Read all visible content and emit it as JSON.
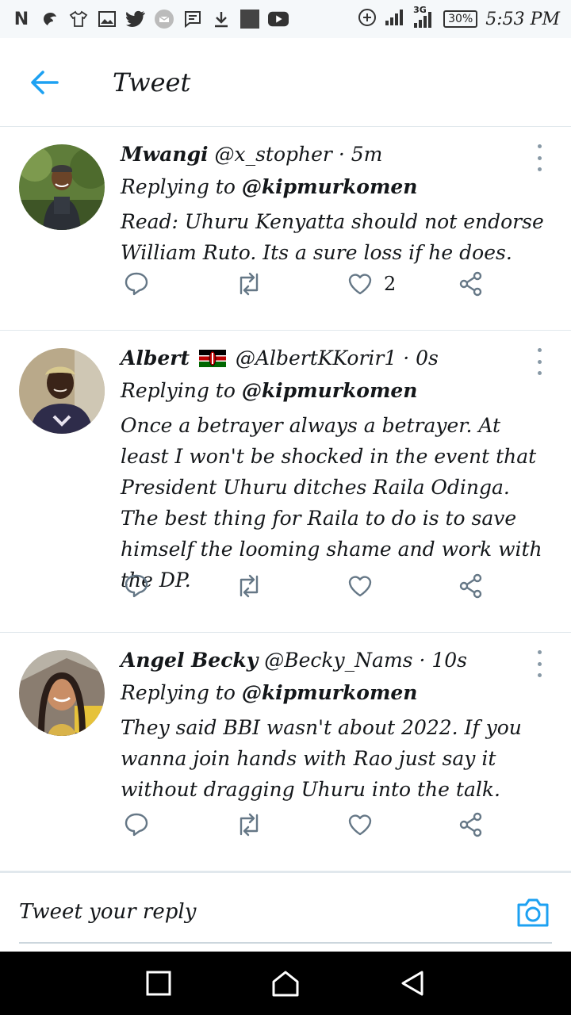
{
  "status_bar": {
    "left_icons": [
      "netflix-icon",
      "game-icon",
      "shirt-icon",
      "gallery-icon",
      "twitter-icon",
      "messenger-icon",
      "sms-icon",
      "download-icon",
      "square-icon",
      "youtube-icon"
    ],
    "network_label": "3G",
    "battery": "30%",
    "time": "5:53 PM"
  },
  "header": {
    "title": "Tweet"
  },
  "tweets": [
    {
      "name": "Mwangi",
      "handle": "@x_stopher",
      "time": "· 5m",
      "replying_prefix": "Replying to",
      "replying_to": "@kipmurkomen",
      "text": "Read: Uhuru Kenyatta should not endorse William Ruto. Its a sure loss if he does.",
      "likes": "2"
    },
    {
      "name": "Albert",
      "flag": "kenya-flag",
      "handle": "@AlbertKKorir1",
      "time": "· 0s",
      "replying_prefix": "Replying to",
      "replying_to": "@kipmurkomen",
      "text": "Once a betrayer always a betrayer. At least I won't be shocked in the event that President Uhuru ditches Raila Odinga. The best thing for Raila to do is to save himself the looming shame and work with the DP.",
      "likes": ""
    },
    {
      "name": "Angel Becky",
      "handle": "@Becky_Nams",
      "time": "· 10s",
      "replying_prefix": "Replying to",
      "replying_to": "@kipmurkomen",
      "text": "They said BBI wasn't about 2022. If you wanna join hands with Rao just say it without dragging Uhuru into the talk.",
      "likes": ""
    }
  ],
  "reply_bar": {
    "placeholder": "Tweet your reply"
  },
  "colors": {
    "accent": "#1da1f2",
    "icon_gray": "#657786",
    "divider": "#e1e8ed"
  }
}
